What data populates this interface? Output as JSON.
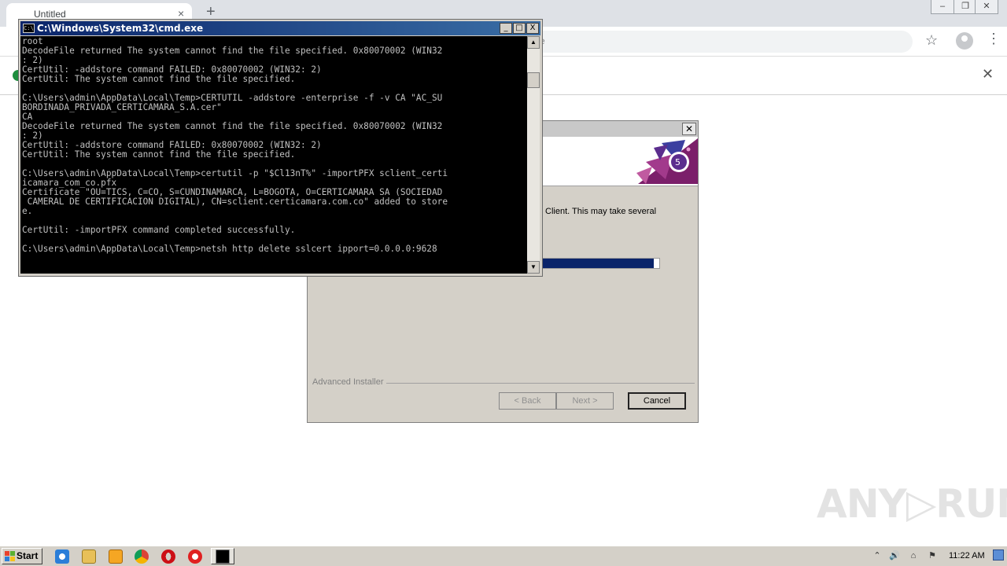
{
  "browser": {
    "tab_title": "Untitled",
    "tab_close": "×",
    "new_tab": "+",
    "omnibox_tail": "e",
    "bookmark_icon": "☆",
    "menu_icon": "⋮",
    "infobar_close": "✕",
    "window_buttons": [
      "‒",
      "❐",
      "✕"
    ]
  },
  "installer": {
    "close": "✕",
    "status_text": "Client.  This may take several",
    "progress": 0.95,
    "brand": "Advanced Installer",
    "back_label": "< Back",
    "next_label": "Next >",
    "cancel_label": "Cancel"
  },
  "cmd": {
    "title": "C:\\Windows\\System32\\cmd.exe",
    "icon_text": "C:\\",
    "buttons": [
      "_",
      "□",
      "X"
    ],
    "lines": [
      "root",
      "DecodeFile returned The system cannot find the file specified. 0x80070002 (WIN32",
      ": 2)",
      "CertUtil: -addstore command FAILED: 0x80070002 (WIN32: 2)",
      "CertUtil: The system cannot find the file specified.",
      "",
      "C:\\Users\\admin\\AppData\\Local\\Temp>CERTUTIL -addstore -enterprise -f -v CA \"AC_SU",
      "BORDINADA_PRIVADA_CERTICAMARA_S.A.cer\"",
      "CA",
      "DecodeFile returned The system cannot find the file specified. 0x80070002 (WIN32",
      ": 2)",
      "CertUtil: -addstore command FAILED: 0x80070002 (WIN32: 2)",
      "CertUtil: The system cannot find the file specified.",
      "",
      "C:\\Users\\admin\\AppData\\Local\\Temp>certutil -p \"$Cl13nT%\" -importPFX sclient_certi",
      "icamara_com_co.pfx",
      "Certificate \"OU=TICS, C=CO, S=CUNDINAMARCA, L=BOGOTA, O=CERTICAMARA SA (SOCIEDAD",
      " CAMERAL DE CERTIFICACION DIGITAL), CN=sclient.certicamara.com.co\" added to store",
      "e.",
      "",
      "CertUtil: -importPFX command completed successfully.",
      "",
      "C:\\Users\\admin\\AppData\\Local\\Temp>netsh http delete sslcert ipport=0.0.0.0:9628"
    ],
    "scroll_up": "▲",
    "scroll_down": "▼"
  },
  "watermark": "ANY▷RUN",
  "taskbar": {
    "start_label": "Start",
    "clock": "11:22 AM",
    "icons": [
      "ie-icon",
      "explorer-icon",
      "media-player-icon",
      "chrome-icon",
      "opera-icon",
      "record-icon",
      "cmd-icon"
    ],
    "tray": [
      "⌃",
      "🔊",
      "⌂",
      "⚑"
    ]
  }
}
